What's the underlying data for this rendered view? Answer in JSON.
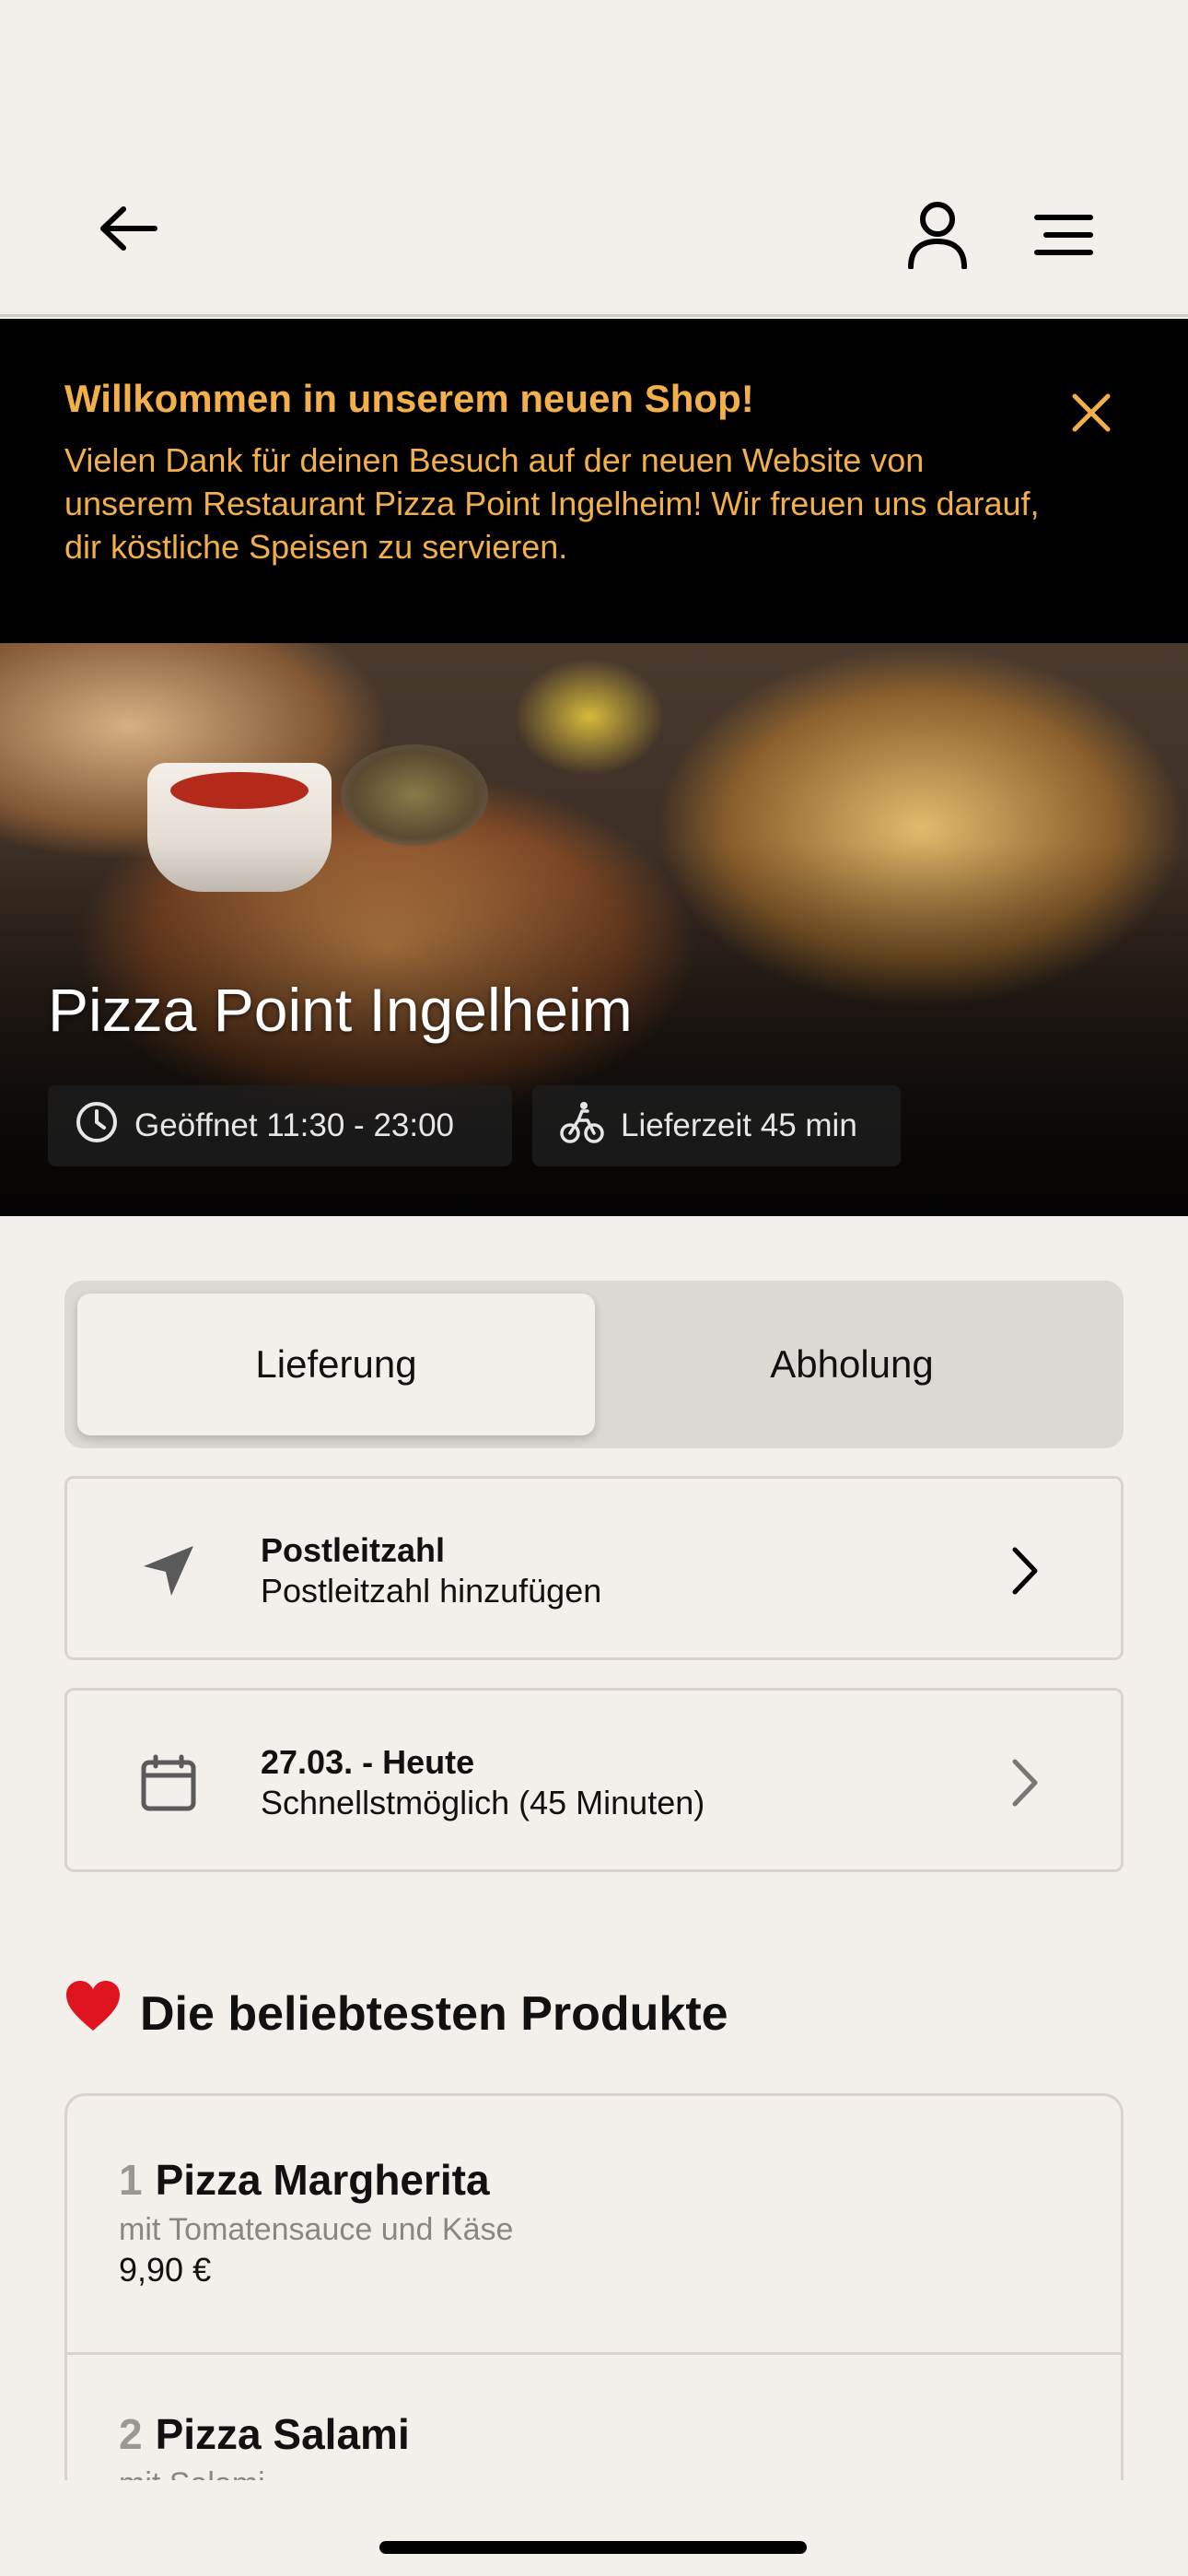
{
  "header": {
    "back_icon": "arrow-left-icon",
    "user_icon": "user-icon",
    "menu_icon": "hamburger-menu-icon"
  },
  "banner": {
    "title": "Willkommen in unserem neuen Shop!",
    "text": "Vielen Dank für deinen Besuch auf der neuen Website von unserem Restaurant Pizza Point Ingelheim! Wir freuen uns darauf, dir köstliche Speisen zu servieren.",
    "close_icon": "close-icon",
    "color": "#f3b04a"
  },
  "hero": {
    "restaurant_name": "Pizza Point Ingelheim",
    "opening_hours": "Geöffnet 11:30 - 23:00",
    "delivery_time": "Lieferzeit 45 min"
  },
  "order_type": {
    "options": [
      "Lieferung",
      "Abholung"
    ],
    "selected": "Lieferung"
  },
  "postal_code": {
    "label": "Postleitzahl",
    "value": "Postleitzahl hinzufügen",
    "icon": "location-arrow-icon"
  },
  "schedule": {
    "label": "27.03. - Heute",
    "value": "Schnellstmöglich (45 Minuten)",
    "icon": "calendar-icon"
  },
  "popular": {
    "title": "Die beliebtesten Produkte",
    "emoji": "❤️",
    "items": [
      {
        "num": "1",
        "name": "Pizza Margherita",
        "desc": "mit Tomatensauce und Käse",
        "price": "9,90 €"
      },
      {
        "num": "2",
        "name": "Pizza Salami",
        "desc": "mit Salami",
        "price": ""
      }
    ]
  }
}
